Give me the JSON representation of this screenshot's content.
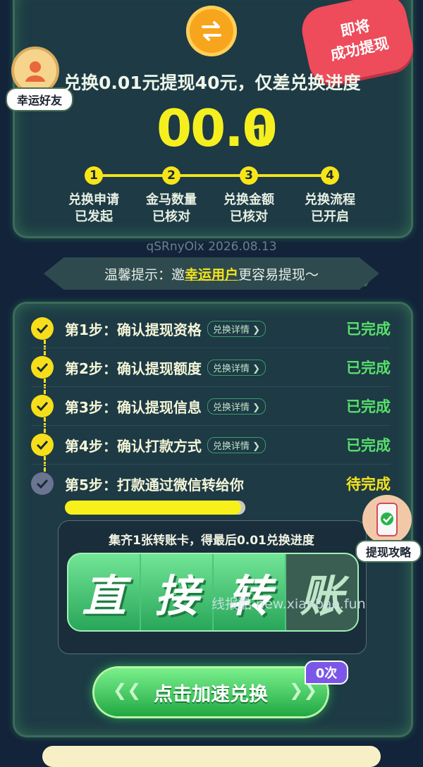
{
  "header": {
    "ribbon_line1": "即将",
    "ribbon_line2": "成功提现",
    "lucky_badge": "幸运好友",
    "headline": "兑换0.01元提现40元，仅差兑换进度",
    "amount_main": "00.0",
    "amount_suffix": "1",
    "steps": [
      {
        "num": "1",
        "line1": "兑换申请",
        "line2": "已发起"
      },
      {
        "num": "2",
        "line1": "金马数量",
        "line2": "已核对"
      },
      {
        "num": "3",
        "line1": "兑换金额",
        "line2": "已核对"
      },
      {
        "num": "4",
        "line1": "兑换流程",
        "line2": "已开启"
      }
    ],
    "code_date": "qSRnyOlx 2026.08.13"
  },
  "tip": {
    "prefix": "温馨提示：邀",
    "highlight": "幸运用户",
    "suffix": "更容易提现～"
  },
  "tasks": [
    {
      "title": "第1步：确认提现资格",
      "detail": "兑换详情",
      "status": "已完成"
    },
    {
      "title": "第2步：确认提现额度",
      "detail": "兑换详情",
      "status": "已完成"
    },
    {
      "title": "第3步：确认提现信息",
      "detail": "兑换详情",
      "status": "已完成"
    },
    {
      "title": "第4步：确认打款方式",
      "detail": "兑换详情",
      "status": "已完成"
    },
    {
      "title": "第5步：打款通过微信转给你",
      "detail": "",
      "status": "待完成"
    }
  ],
  "progress_fraction": 0.97,
  "card": {
    "title": "集齐1张转账卡，得最后0.01兑换进度",
    "chars": [
      "直",
      "接",
      "转",
      "账"
    ]
  },
  "watermark": "线报酷 new.xianbao.fun",
  "guide_label": "提现攻略",
  "cta": {
    "label": "点击加速兑换",
    "count": "0次"
  },
  "colors": {
    "accent_yellow": "#f5ef20",
    "success_green": "#58e06a",
    "background": "#12233a"
  }
}
